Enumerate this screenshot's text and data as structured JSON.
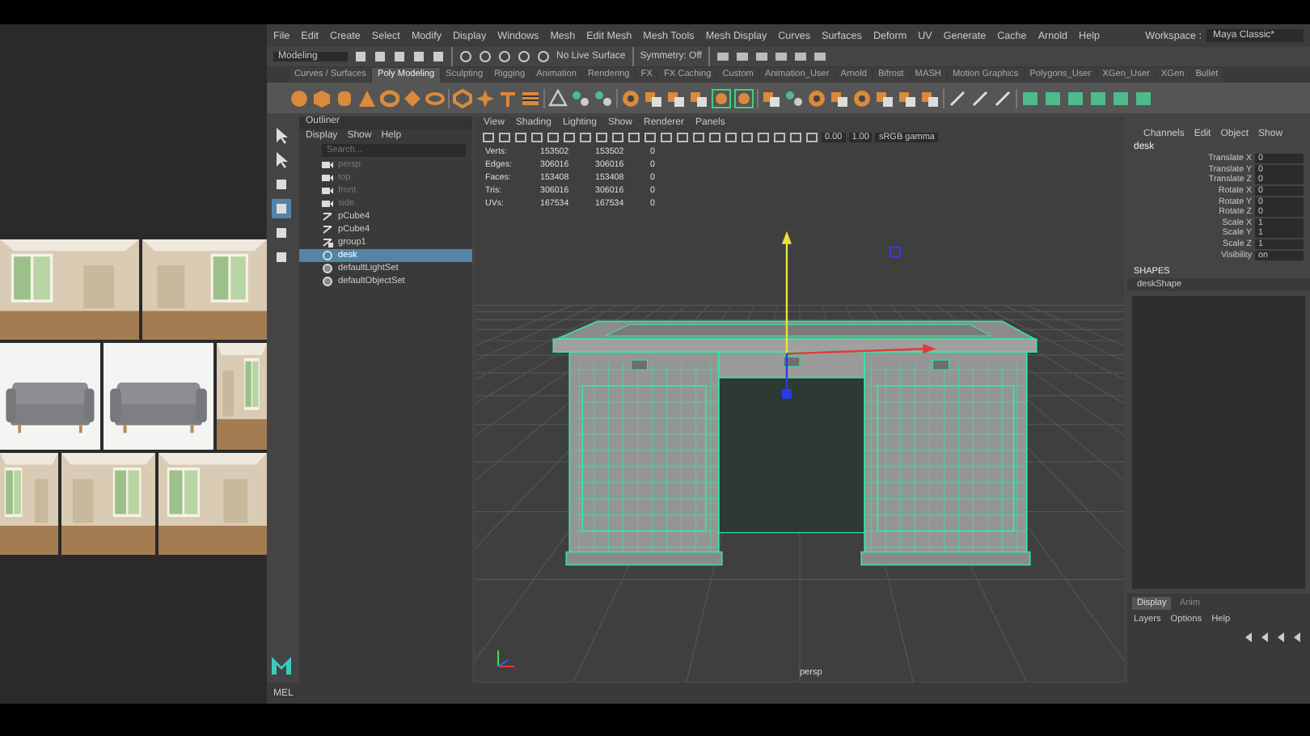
{
  "menu_bar": {
    "items": [
      "File",
      "Edit",
      "Create",
      "Select",
      "Modify",
      "Display",
      "Windows",
      "Mesh",
      "Edit Mesh",
      "Mesh Tools",
      "Mesh Display",
      "Curves",
      "Surfaces",
      "Deform",
      "UV",
      "Generate",
      "Cache",
      "Arnold",
      "Help"
    ],
    "workspace_label": "Workspace :",
    "workspace": "Maya Classic*"
  },
  "status_line": {
    "mode": "Modeling",
    "live_surface": "No Live Surface",
    "symmetry": "Symmetry: Off"
  },
  "shelf_tabs": [
    {
      "label": "Curves / Surfaces",
      "selected": false
    },
    {
      "label": "Poly Modeling",
      "selected": true
    },
    {
      "label": "Sculpting",
      "selected": false
    },
    {
      "label": "Rigging",
      "selected": false
    },
    {
      "label": "Animation",
      "selected": false
    },
    {
      "label": "Rendering",
      "selected": false
    },
    {
      "label": "FX",
      "selected": false
    },
    {
      "label": "FX Caching",
      "selected": false
    },
    {
      "label": "Custom",
      "selected": false
    },
    {
      "label": "Animation_User",
      "selected": false
    },
    {
      "label": "Arnold",
      "selected": false
    },
    {
      "label": "Bifrost",
      "selected": false
    },
    {
      "label": "MASH",
      "selected": false
    },
    {
      "label": "Motion Graphics",
      "selected": false
    },
    {
      "label": "Polygons_User",
      "selected": false
    },
    {
      "label": "XGen_User",
      "selected": false
    },
    {
      "label": "XGen",
      "selected": false
    },
    {
      "label": "Bullet",
      "selected": false
    }
  ],
  "outliner": {
    "title": "Outliner",
    "menus": [
      "Display",
      "Show",
      "Help"
    ],
    "search": {
      "placeholder": "Search..."
    },
    "items": [
      {
        "label": "persp",
        "kind": "camera",
        "selected": false
      },
      {
        "label": "top",
        "kind": "camera",
        "selected": false
      },
      {
        "label": "front",
        "kind": "camera",
        "selected": false
      },
      {
        "label": "side",
        "kind": "camera",
        "selected": false
      },
      {
        "label": "pCube4",
        "kind": "mesh",
        "selected": false
      },
      {
        "label": "pCube4",
        "kind": "mesh",
        "selected": false
      },
      {
        "label": "group1",
        "kind": "group",
        "selected": false
      },
      {
        "label": "desk",
        "kind": "transform",
        "selected": true
      },
      {
        "label": "defaultLightSet",
        "kind": "set",
        "selected": false
      },
      {
        "label": "defaultObjectSet",
        "kind": "set",
        "selected": false
      }
    ]
  },
  "viewport": {
    "menus": [
      "View",
      "Shading",
      "Lighting",
      "Show",
      "Renderer",
      "Panels"
    ],
    "exposure": "0.00",
    "gamma": "1.00",
    "color_space": "sRGB gamma",
    "camera": "persp",
    "stats": [
      [
        "Verts:",
        "153502",
        "153502",
        "0"
      ],
      [
        "Edges:",
        "306016",
        "306016",
        "0"
      ],
      [
        "Faces:",
        "153408",
        "153408",
        "0"
      ],
      [
        "Tris:",
        "306016",
        "306016",
        "0"
      ],
      [
        "UVs:",
        "167534",
        "167534",
        "0"
      ]
    ]
  },
  "channel_box": {
    "menus": [
      "Channels",
      "Edit",
      "Object",
      "Show"
    ],
    "object": "desk",
    "attributes": [
      [
        "Translate X",
        "0"
      ],
      [
        "Translate Y",
        "0"
      ],
      [
        "Translate Z",
        "0"
      ],
      [
        "Rotate X",
        "0"
      ],
      [
        "Rotate Y",
        "0"
      ],
      [
        "Rotate Z",
        "0"
      ],
      [
        "Scale X",
        "1"
      ],
      [
        "Scale Y",
        "1"
      ],
      [
        "Scale Z",
        "1"
      ],
      [
        "Visibility",
        "on"
      ]
    ],
    "shapes_heading": "SHAPES",
    "shape": "deskShape"
  },
  "layer_editor": {
    "tabs": [
      {
        "label": "Display",
        "selected": true
      },
      {
        "label": "Anim",
        "selected": false
      }
    ],
    "menus": [
      "Layers",
      "Options",
      "Help"
    ]
  },
  "command_line": {
    "language": "MEL"
  }
}
